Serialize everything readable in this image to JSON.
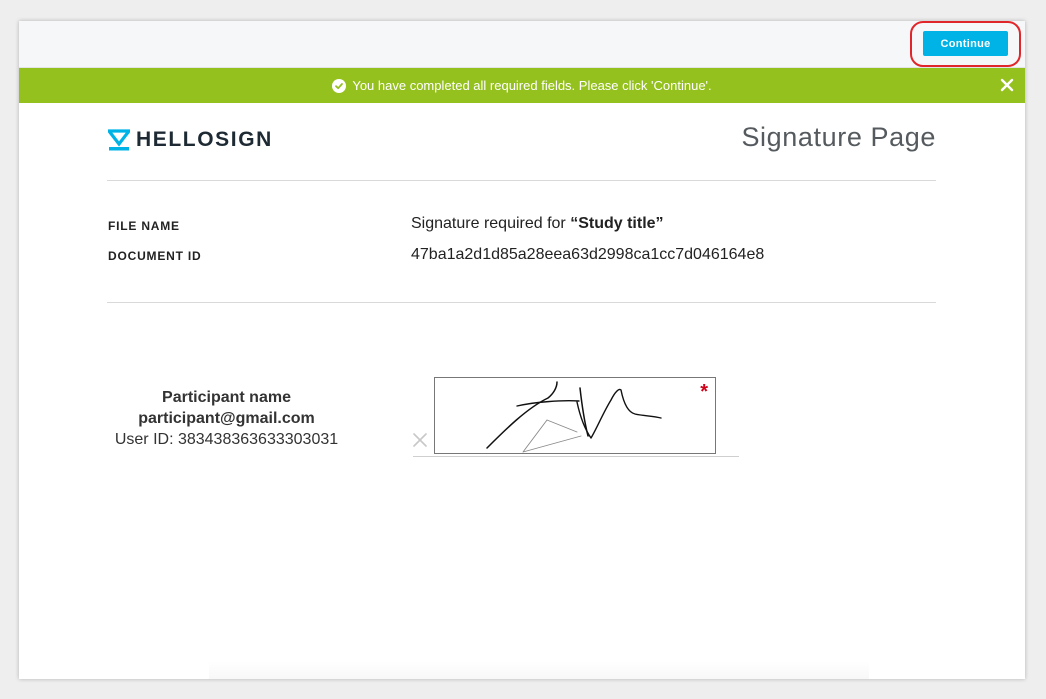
{
  "toolbar": {
    "continue_label": "Continue"
  },
  "banner": {
    "message": "You have completed all required fields. Please click 'Continue'.",
    "icon": "check-circle-icon",
    "close_icon": "close-icon",
    "color": "#95c11f"
  },
  "brand": {
    "logo_text": "HELLOSIGN",
    "accent": "#00b3e6"
  },
  "page": {
    "title": "Signature Page"
  },
  "document": {
    "file_name_label": "FILE NAME",
    "file_name_prefix": "Signature required for ",
    "file_name_title": "“Study title”",
    "document_id_label": "DOCUMENT ID",
    "document_id": "47ba1a2d1d85a28eea63d2998ca1cc7d046164e8"
  },
  "signer": {
    "name": "Participant name",
    "email": "participant@gmail.com",
    "user_id": "User ID: 383438363633303031"
  },
  "signature": {
    "required_marker": "*",
    "required_color": "#d0021b",
    "remove_icon": "close-icon"
  }
}
